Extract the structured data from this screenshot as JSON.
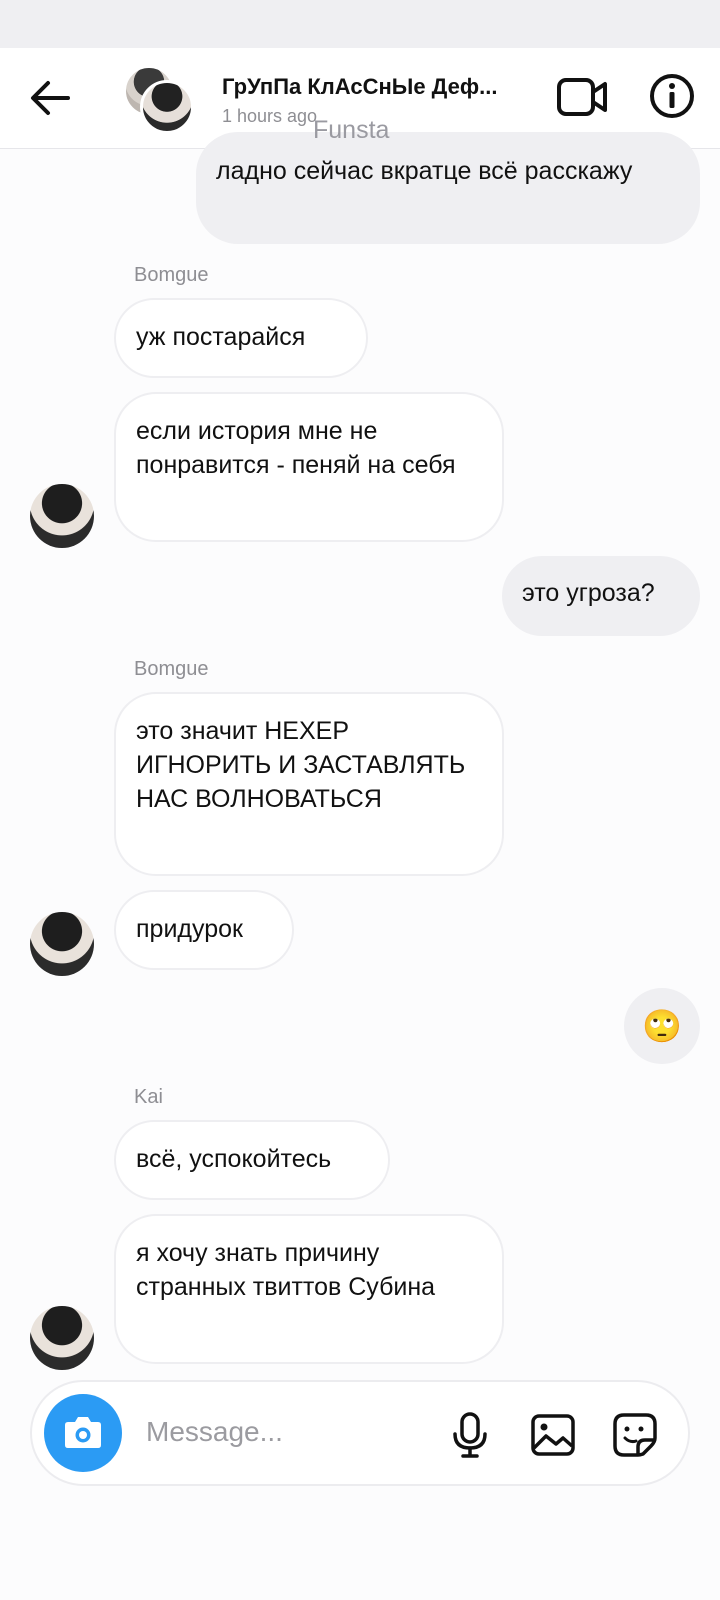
{
  "header": {
    "title": "ГрУпПа КлАсСнЫе Деф...",
    "subtitle": "1 hours ago",
    "watermark": "Funsta"
  },
  "messages": [
    {
      "type": "outgoing",
      "text": "ладно сейчас вкратце всё расскажу"
    },
    {
      "type": "sender",
      "text": "Bomgue"
    },
    {
      "type": "incoming",
      "text": "уж постарайся"
    },
    {
      "type": "incoming",
      "text": "если история мне не понравится - пеняй на себя"
    },
    {
      "type": "outgoing",
      "text": "это угроза?"
    },
    {
      "type": "sender",
      "text": "Bomgue"
    },
    {
      "type": "incoming",
      "text": "это значит НЕХЕР ИГНОРИТЬ И ЗАСТАВЛЯТЬ НАС ВОЛНОВАТЬСЯ"
    },
    {
      "type": "incoming",
      "text": "придурок"
    },
    {
      "type": "outgoing-emoji",
      "text": "🙄"
    },
    {
      "type": "sender",
      "text": "Kai"
    },
    {
      "type": "incoming",
      "text": "всё, успокойтесь"
    },
    {
      "type": "incoming",
      "text": "я хочу знать причину странных твиттов Субина"
    }
  ],
  "composer": {
    "placeholder": "Message..."
  },
  "icons": {
    "back": "arrow-left-icon",
    "video": "video-camera-icon",
    "info": "info-icon",
    "camera": "camera-icon",
    "mic": "microphone-icon",
    "gallery": "image-icon",
    "sticker": "sticker-icon"
  },
  "colors": {
    "accent": "#2b9bf4",
    "outgoing_bubble": "#efeff2",
    "secondary_text": "#8e8e93"
  }
}
